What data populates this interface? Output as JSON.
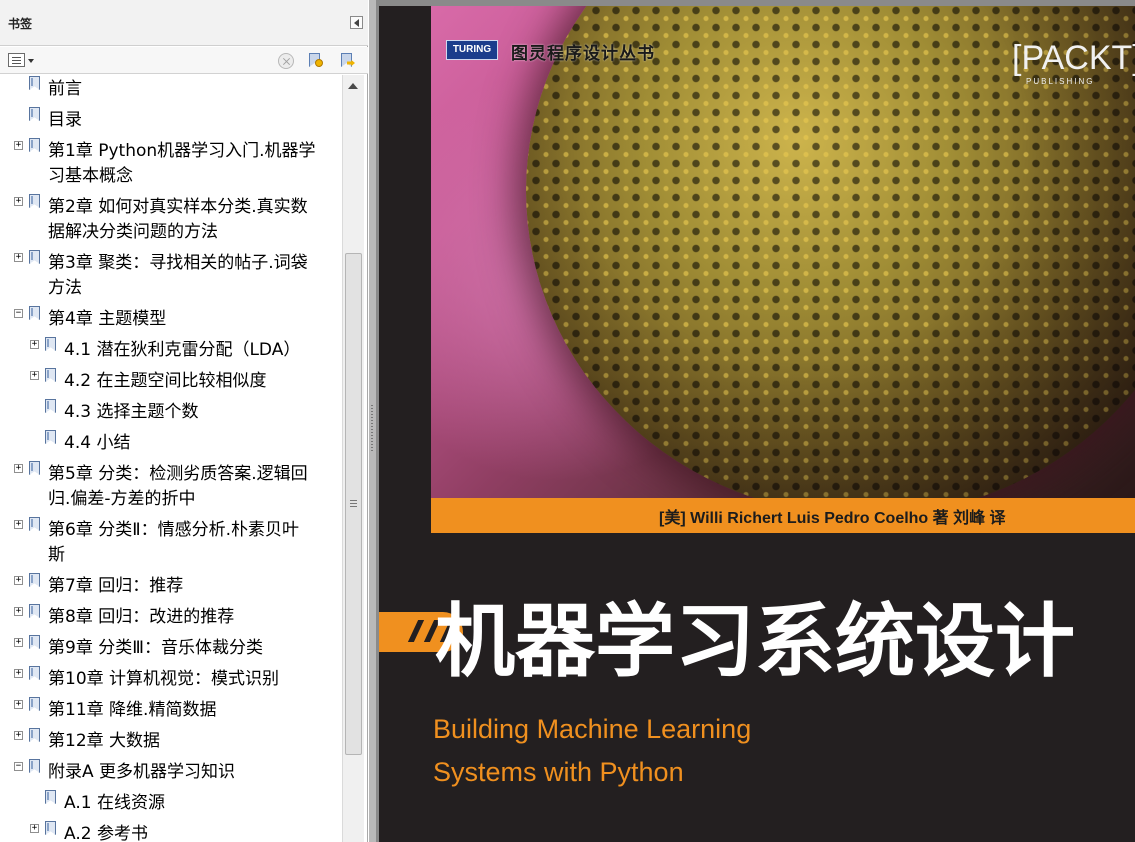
{
  "panel": {
    "title": "书签"
  },
  "bookmarks": [
    {
      "label": "前言",
      "expander": "",
      "level": 0
    },
    {
      "label": "目录",
      "expander": "",
      "level": 0
    },
    {
      "label": "第1章 Python机器学习入门.机器学",
      "label2": "习基本概念",
      "expander": "+",
      "level": 0
    },
    {
      "label": "第2章 如何对真实样本分类.真实数",
      "label2": "据解决分类问题的方法",
      "expander": "+",
      "level": 0
    },
    {
      "label": "第3章 聚类：寻找相关的帖子.词袋",
      "label2": "方法",
      "expander": "+",
      "level": 0
    },
    {
      "label": "第4章 主题模型",
      "expander": "−",
      "level": 0
    },
    {
      "label": "4.1 潜在狄利克雷分配（LDA）",
      "expander": "+",
      "level": 1
    },
    {
      "label": "4.2 在主题空间比较相似度",
      "expander": "+",
      "level": 1
    },
    {
      "label": "4.3 选择主题个数",
      "expander": "",
      "level": 1
    },
    {
      "label": "4.4 小结",
      "expander": "",
      "level": 1
    },
    {
      "label": "第5章 分类：检测劣质答案.逻辑回",
      "label2": "归.偏差-方差的折中",
      "expander": "+",
      "level": 0
    },
    {
      "label": "第6章 分类Ⅱ：情感分析.朴素贝叶",
      "label2": "斯",
      "expander": "+",
      "level": 0
    },
    {
      "label": "第7章 回归：推荐",
      "expander": "+",
      "level": 0
    },
    {
      "label": "第8章 回归：改进的推荐",
      "expander": "+",
      "level": 0
    },
    {
      "label": "第9章 分类Ⅲ：音乐体裁分类",
      "expander": "+",
      "level": 0
    },
    {
      "label": "第10章 计算机视觉：模式识别",
      "expander": "+",
      "level": 0
    },
    {
      "label": "第11章 降维.精简数据",
      "expander": "+",
      "level": 0
    },
    {
      "label": "第12章 大数据",
      "expander": "+",
      "level": 0
    },
    {
      "label": "附录A 更多机器学习知识",
      "expander": "−",
      "level": 0
    },
    {
      "label": "A.1 在线资源",
      "expander": "",
      "level": 1
    },
    {
      "label": "A.2 参考书",
      "expander": "+",
      "level": 1
    }
  ],
  "cover": {
    "publisher_logo": "TURING",
    "series": "图灵程序设计丛书",
    "packt": "[PACKT]",
    "packt_sub": "PUBLISHING",
    "authors": "[美]  Willi Richert   Luis Pedro Coelho  著     刘峰  译",
    "title_cn": "机器学习系统设计",
    "title_en_1": "Building Machine Learning",
    "title_en_2": "Systems with Python"
  },
  "colors": {
    "accent_orange": "#f0901f",
    "cover_bg": "#231f20",
    "turing_blue": "#1b3d8c"
  }
}
